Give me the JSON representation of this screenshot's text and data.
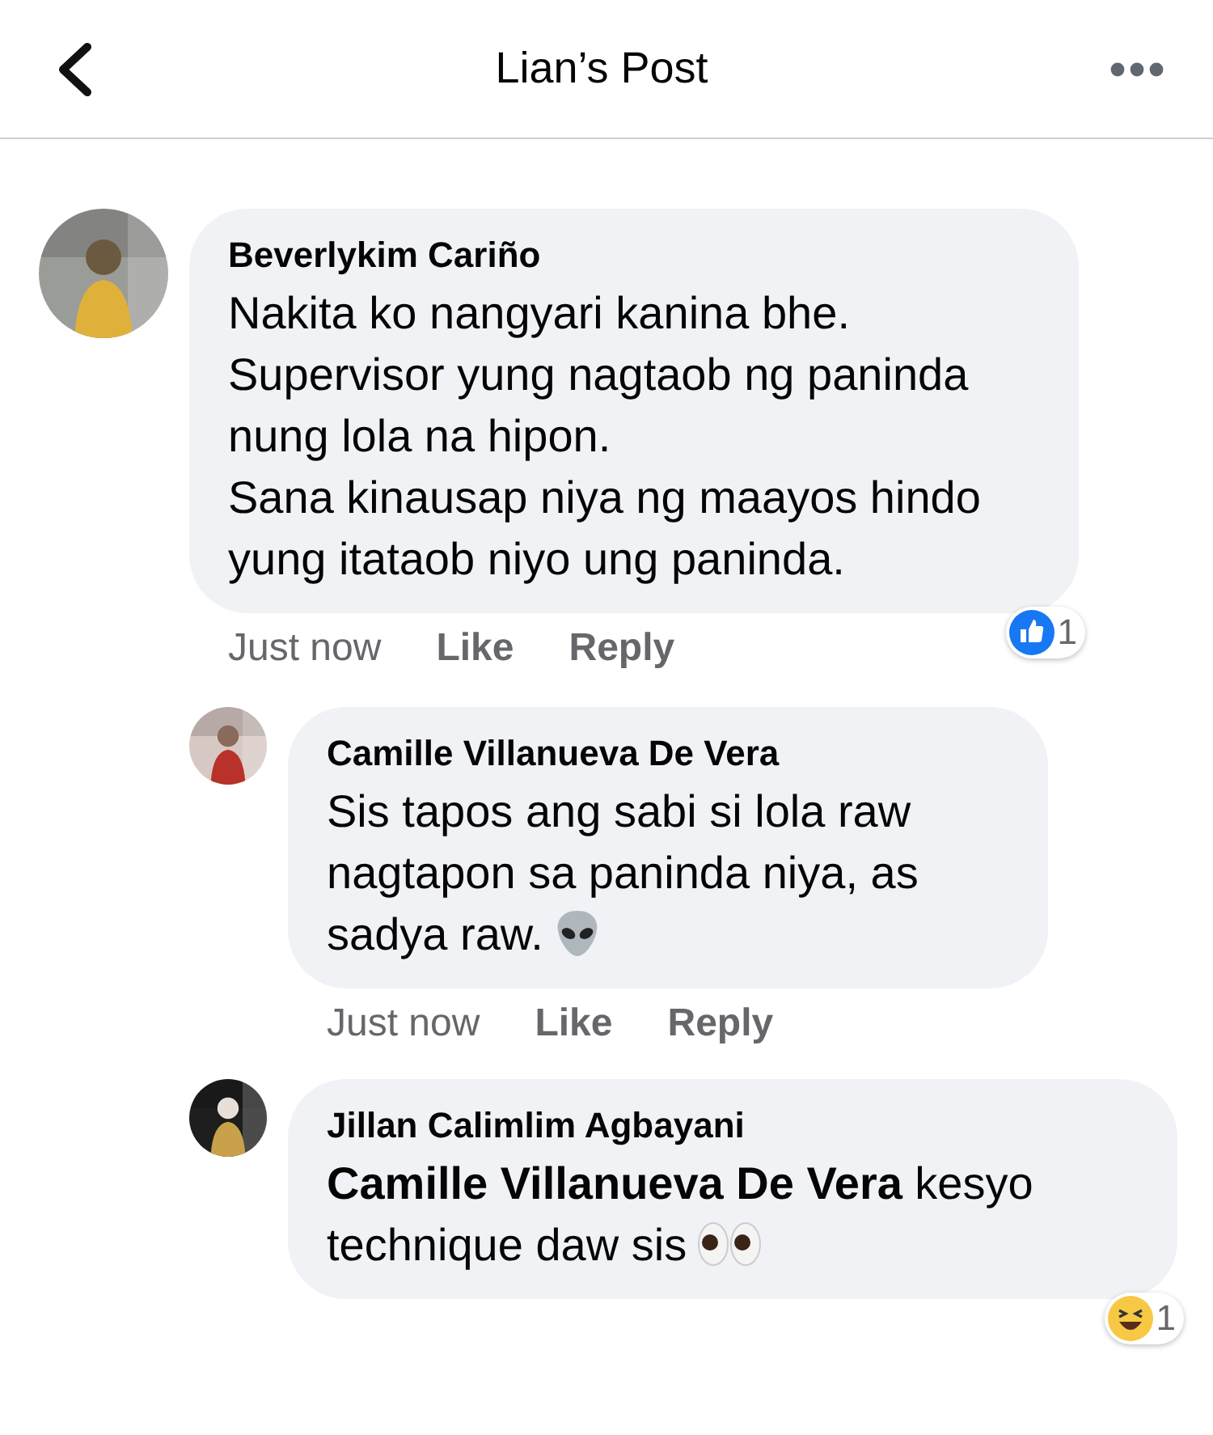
{
  "header": {
    "title": "Lian’s Post"
  },
  "comments": [
    {
      "name": "Beverlykim Cariño",
      "text": "Nakita ko nangyari kanina bhe.\nSupervisor yung nagtaob ng paninda nung lola na hipon.\nSana kinausap niya ng maayos hindo yung itataob niyo ung paninda.",
      "time": "Just now",
      "actions": [
        "Like",
        "Reply"
      ],
      "reaction": {
        "kind": "like",
        "count": "1"
      },
      "replies": [
        {
          "name": "Camille Villanueva De Vera",
          "text": "Sis tapos ang sabi si lola raw nagtapon sa paninda niya, as sadya raw.",
          "emoji": {
            "kind": "alien"
          },
          "time": "Just now",
          "actions": [
            "Like",
            "Reply"
          ]
        },
        {
          "name": "Jillan Calimlim Agbayani",
          "text": "**Camille Villanueva De Vera** kesyo technique daw sis",
          "emoji": {
            "kind": "eyes"
          },
          "reaction": {
            "kind": "laugh",
            "count": "1"
          }
        }
      ]
    }
  ]
}
